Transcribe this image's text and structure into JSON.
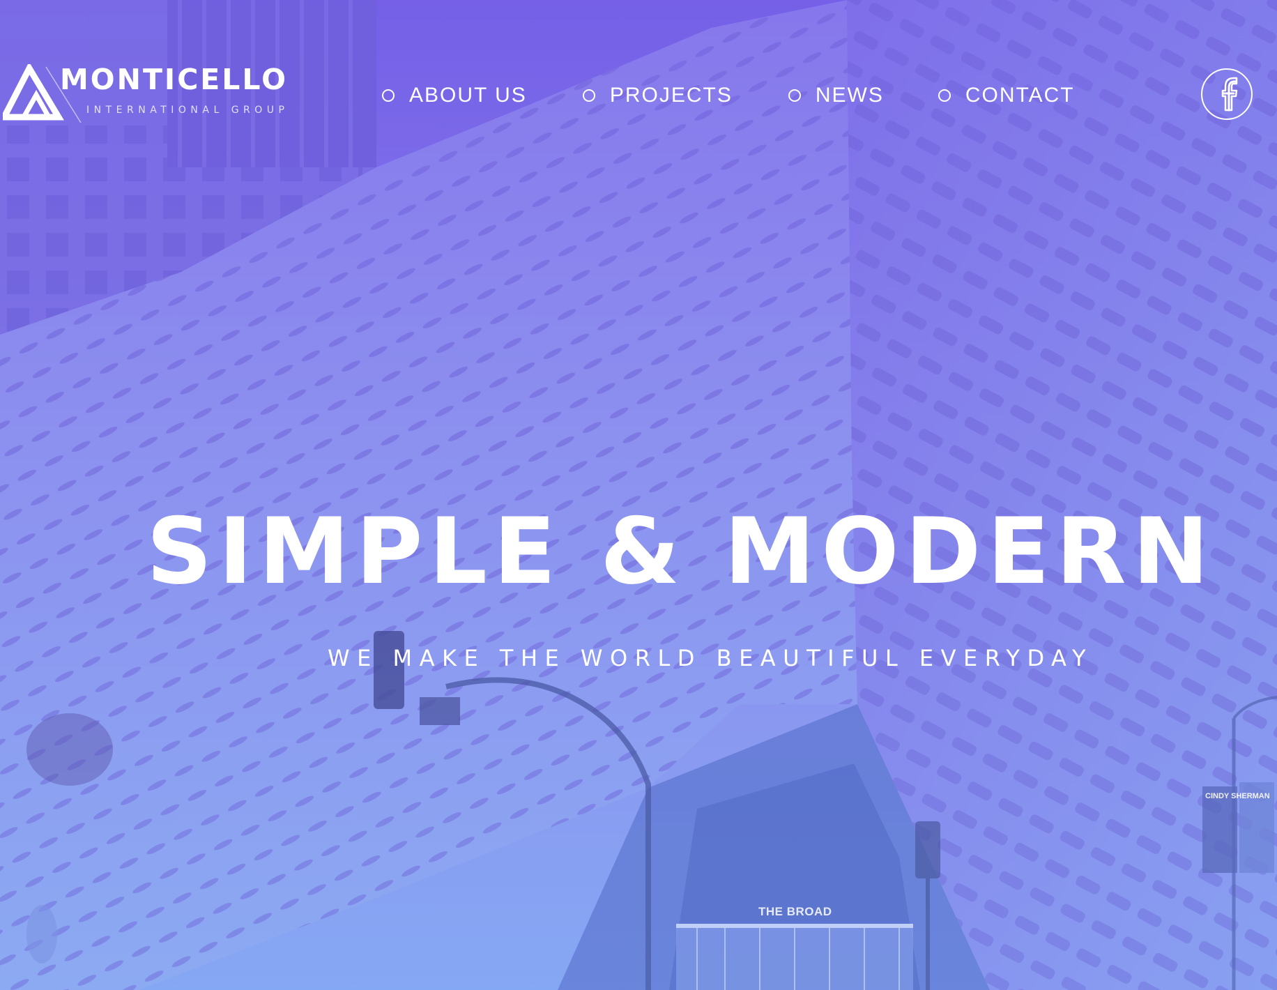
{
  "brand": {
    "name": "MONTICELLO",
    "tagline": "INTERNATIONAL GROUP"
  },
  "nav": {
    "items": [
      {
        "label": "ABOUT US"
      },
      {
        "label": "PROJECTS"
      },
      {
        "label": "NEWS"
      },
      {
        "label": "CONTACT"
      }
    ]
  },
  "social": {
    "facebook_icon": "facebook-icon"
  },
  "hero": {
    "title": "SIMPLE & MODERN",
    "subtitle": "WE MAKE THE WORLD BEAUTIFUL EVERYDAY"
  },
  "background": {
    "building_sign": "THE BROAD",
    "poster_text": "CINDY SHERMAN"
  },
  "colors": {
    "overlay_top": "#7460e6",
    "overlay_bottom": "#86a7f3",
    "text": "#ffffff"
  }
}
